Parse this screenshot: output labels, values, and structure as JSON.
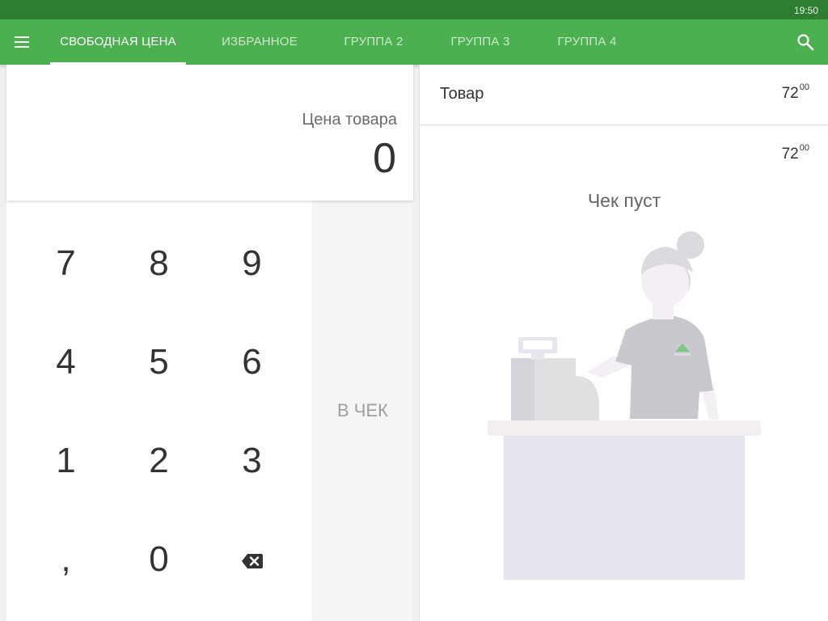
{
  "status_bar": {
    "time": "19:50"
  },
  "app_bar": {
    "tabs": [
      {
        "label": "СВОБОДНАЯ ЦЕНА"
      },
      {
        "label": "ИЗБРАННОЕ"
      },
      {
        "label": "ГРУППА 2"
      },
      {
        "label": "ГРУППА 3"
      },
      {
        "label": "ГРУППА 4"
      }
    ],
    "active_tab": 0,
    "menu_icon": "hamburger-menu-icon",
    "search_icon": "search-icon"
  },
  "price_entry": {
    "label": "Цена товара",
    "value": "0"
  },
  "keypad": {
    "keys": [
      "7",
      "8",
      "9",
      "4",
      "5",
      "6",
      "1",
      "2",
      "3",
      ",",
      "0"
    ],
    "backspace_icon": "backspace-icon",
    "to_check_label": "В ЧЕК"
  },
  "receipt": {
    "item": {
      "name": "Товар",
      "price_int": "72",
      "price_frac": "00"
    },
    "total": {
      "int": "72",
      "frac": "00"
    },
    "empty_text": "Чек пуст",
    "illustration": "cashier-illustration"
  },
  "colors": {
    "status_bar": "#2e7d32",
    "app_bar": "#4caf50",
    "accent": "#ffffff"
  }
}
